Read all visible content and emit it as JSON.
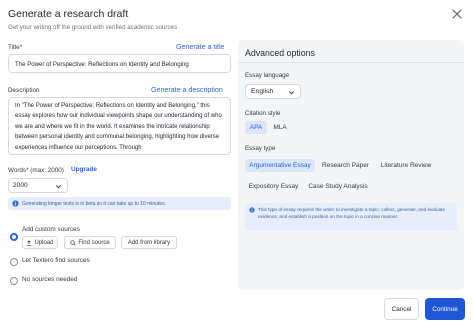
{
  "header": {
    "title": "Generate a research draft",
    "subtitle": "Get your writing off the ground with verified academic sources"
  },
  "form": {
    "title_label": "Title*",
    "generate_title_link": "Generate a title",
    "title_value": "The Power of Perspective: Reflections on Identity and Belonging",
    "description_label": "Description",
    "generate_description_link": "Generate a description",
    "description_value": "In \"The Power of Perspective: Reflections on Identity and Belonging,\" this essay explores how our individual viewpoints shape our understanding of who we are and where we fit in the world. It examines the intricate relationship between personal identity and communal belonging, highlighting how diverse experiences influence our perceptions. Through",
    "words_label": "Words* (max: 2000)",
    "upgrade_link": "Upgrade",
    "words_value": "2000",
    "info_text": "Generating longer texts is in beta so it can take up to 10 minutes."
  },
  "sources": {
    "options": [
      {
        "label": "Add custom sources",
        "selected": true
      },
      {
        "label": "Let Textero find sources",
        "selected": false
      },
      {
        "label": "No sources needed",
        "selected": false
      }
    ],
    "buttons": {
      "upload": "Upload",
      "find_source": "Find source",
      "add_from_library": "Add from library"
    }
  },
  "advanced": {
    "title": "Advanced options",
    "language_label": "Essay language",
    "language_value": "English",
    "citation_label": "Citation style",
    "citation_options": [
      "APA",
      "MLA"
    ],
    "citation_selected": "APA",
    "type_label": "Essay type",
    "type_options": [
      "Argumentative Essay",
      "Research Paper",
      "Literature Review",
      "Expository Essay",
      "Case Study Analysis"
    ],
    "type_selected": "Argumentative Essay",
    "type_note": "This type of essay requires the writer to investigate a topic; collect, generate, and evaluate evidence; and establish a position on the topic in a concise manner."
  },
  "footer": {
    "cancel": "Cancel",
    "continue": "Continue"
  },
  "colors": {
    "accent": "#2a66d9",
    "primary_button": "#1e56d6",
    "info_bg": "#e6eefc",
    "panel_bg": "#f4f5f7"
  },
  "icons": [
    "close-icon",
    "chevron-down-icon",
    "info-icon",
    "upload-icon",
    "search-icon"
  ]
}
